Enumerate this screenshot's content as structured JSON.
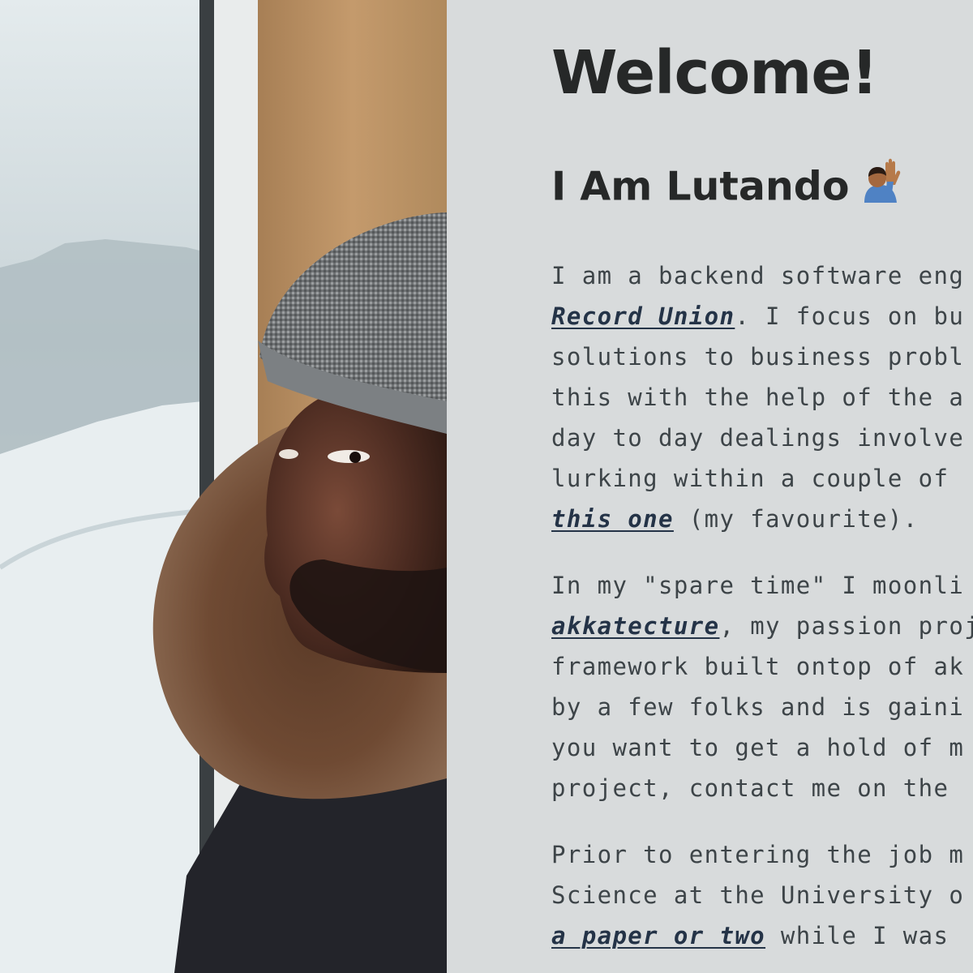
{
  "header": {
    "welcome": "Welcome!",
    "name": "I Am Lutando",
    "emoji": "raising-hand-emoji"
  },
  "paragraphs": {
    "p1": {
      "l1": "I am a backend software eng",
      "l2_link": "Record Union",
      "l2_rest": ". I focus on bu",
      "l3": "solutions to business probl",
      "l4": "this with the help of the a",
      "l5": "day to day dealings involve",
      "l6": "lurking within a couple of ",
      "l7_link": "this one",
      "l7_rest": " (my favourite)."
    },
    "p2": {
      "l1": "In my \"spare time\" I moonli",
      "l2_link": "akkatecture",
      "l2_rest": ", my passion proj",
      "l3": "framework built ontop of ak",
      "l4": "by a few folks and is gaini",
      "l5": "you want to get a hold of m",
      "l6": "project, contact me on the "
    },
    "p3": {
      "l1": "Prior to entering the job m",
      "l2": "Science at the University o",
      "l3_link": "a paper or two",
      "l3_rest": " while I was "
    }
  },
  "colors": {
    "background": "#d8dbdc",
    "heading": "#262828",
    "body_text": "#3d4448",
    "link": "#243347"
  }
}
